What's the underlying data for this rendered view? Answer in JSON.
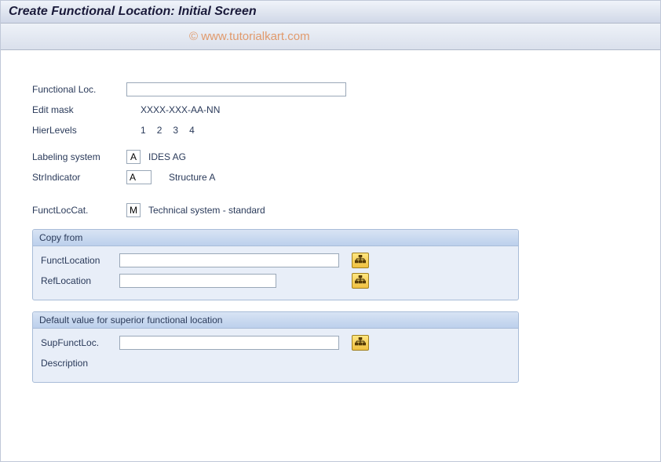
{
  "header": {
    "title": "Create Functional Location: Initial Screen"
  },
  "watermark": "© www.tutorialkart.com",
  "fields": {
    "func_loc_label": "Functional Loc.",
    "func_loc_value": "",
    "edit_mask_label": "Edit mask",
    "edit_mask_value": "XXXX-XXX-AA-NN",
    "hier_levels_label": "HierLevels",
    "hier_levels": [
      "1",
      "2",
      "3",
      "4"
    ],
    "labeling_system_label": "Labeling system",
    "labeling_system_value": "A",
    "labeling_system_desc": "IDES AG",
    "str_indicator_label": "StrIndicator",
    "str_indicator_value": "A",
    "str_indicator_desc": "Structure A",
    "funct_loc_cat_label": "FunctLocCat.",
    "funct_loc_cat_value": "M",
    "funct_loc_cat_desc": "Technical system - standard"
  },
  "groups": {
    "copy_from": {
      "title": "Copy from",
      "funct_location_label": "FunctLocation",
      "funct_location_value": "",
      "ref_location_label": "RefLocation",
      "ref_location_value": ""
    },
    "default_value": {
      "title": "Default value for superior functional location",
      "sup_funct_loc_label": "SupFunctLoc.",
      "sup_funct_loc_value": "",
      "description_label": "Description",
      "description_value": ""
    }
  }
}
